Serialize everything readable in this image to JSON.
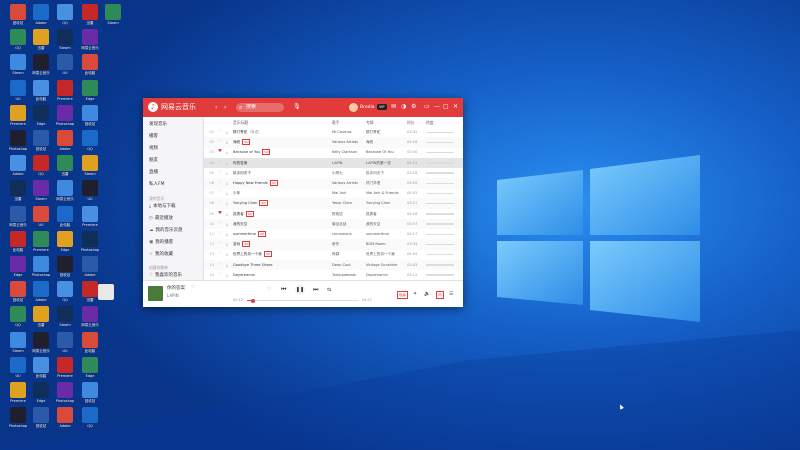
{
  "desktop": {
    "icon_labels": [
      "回收站",
      "QQ",
      "Steam",
      "UU",
      "Premiere",
      "Photoshop",
      "Adobe",
      "迅雷",
      "网易云音乐",
      "此电脑",
      "Edge"
    ],
    "colors": {
      "wallpaper_dark": "#0a3f9e",
      "wallpaper_light": "#1f7be0",
      "logo_panes": "#3aa0f5"
    }
  },
  "window": {
    "app_name": "网易云音乐",
    "accent_color": "#e13b3b",
    "search_placeholder": "搜索",
    "user_name": "Brodie",
    "vip_label": "VIP",
    "toolbar_icons": [
      "mail-icon",
      "theme-icon",
      "settings-icon",
      "mini-mode-icon",
      "minimize-icon",
      "maximize-icon",
      "close-icon"
    ]
  },
  "sidebar": {
    "items": [
      "发现音乐",
      "播客",
      "视频",
      "朋友",
      "直播",
      "私人FM"
    ],
    "section_my_music": "我的音乐",
    "my_music_items": [
      "本地与下载",
      "最近播放",
      "我的音乐云盘",
      "我的播客",
      "我的收藏"
    ],
    "section_playlists": "创建的歌单",
    "playlist_items": [
      "我喜欢的音乐"
    ]
  },
  "list": {
    "columns": [
      "音乐标题",
      "歌手",
      "专辑",
      "时长",
      "热度"
    ],
    "rows": [
      {
        "num": "01",
        "title": "醉打青蛇",
        "alias": "（粤语）",
        "tag": "",
        "artist": "Mr.Cosmos",
        "album": "醉打青蛇",
        "duration": "03:42",
        "liked": false
      },
      {
        "num": "02",
        "title": "海底",
        "alias": "",
        "tag": "SQ",
        "artist": "Various Artists",
        "album": "海底",
        "duration": "04:16",
        "liked": false
      },
      {
        "num": "03",
        "title": "Because of You",
        "alias": "",
        "tag": "SQ",
        "artist": "Kelly Clarkson",
        "album": "Because Of You",
        "duration": "03:40",
        "liked": true
      },
      {
        "num": "04",
        "title": "你的答案",
        "alias": "",
        "tag": "",
        "artist": "LAPIN",
        "album": "LAPIN的第一张",
        "duration": "04:21",
        "liked": false
      },
      {
        "num": "05",
        "title": "执手问天下",
        "alias": "",
        "tag": "",
        "artist": "小阿七",
        "album": "执手问天下",
        "duration": "03:18",
        "liked": false
      },
      {
        "num": "06",
        "title": "Happy New Friends",
        "alias": "",
        "tag": "SQ",
        "artist": "Various Artists",
        "album": "热门华语",
        "duration": "03:55",
        "liked": false
      },
      {
        "num": "07",
        "title": "少年",
        "alias": "",
        "tag": "",
        "artist": "Mai Anh",
        "album": "Mai Anh & Friends",
        "duration": "04:02",
        "liked": false
      },
      {
        "num": "08",
        "title": "Yunying Chen",
        "alias": "",
        "tag": "SQ",
        "artist": "Yesor Chen",
        "album": "Yunying Chen",
        "duration": "03:21",
        "liked": false
      },
      {
        "num": "09",
        "title": "孤勇者",
        "alias": "",
        "tag": "SQ",
        "artist": "陈奕迅",
        "album": "孤勇者",
        "duration": "04:16",
        "liked": true
      },
      {
        "num": "10",
        "title": "我的天空",
        "alias": "",
        "tag": "",
        "artist": "南征北战",
        "album": "我的天空",
        "duration": "03:57",
        "liked": false
      },
      {
        "num": "11",
        "title": "summertime",
        "alias": "",
        "tag": "SQ",
        "artist": "cinnamons",
        "album": "summertime",
        "duration": "04:17",
        "liked": false
      },
      {
        "num": "12",
        "title": "游戏",
        "alias": "",
        "tag": "SQ",
        "artist": "房东",
        "album": "BGM Room",
        "duration": "03:34",
        "liked": false
      },
      {
        "num": "13",
        "title": "世界上的另一个我",
        "alias": "",
        "tag": "SQ",
        "artist": "阿肆",
        "album": "世界上的另一个我",
        "duration": "04:04",
        "liked": false
      },
      {
        "num": "14",
        "title": "Goodbye Three Shoes",
        "alias": "",
        "tag": "",
        "artist": "Deep Cool",
        "album": "Vintage Sunshine",
        "duration": "03:43",
        "liked": false
      },
      {
        "num": "15",
        "title": "Daydreamin",
        "alias": "",
        "tag": "",
        "artist": "Tomppabeats",
        "album": "Daydreamin",
        "duration": "03:12",
        "liked": false
      }
    ]
  },
  "player": {
    "song_title": "你的答案",
    "song_artist": "LAPIN",
    "time_current": "00:12",
    "time_total": "04:21",
    "progress_fraction": 0.05,
    "lyric_label": "词",
    "quality_label": "极高"
  }
}
